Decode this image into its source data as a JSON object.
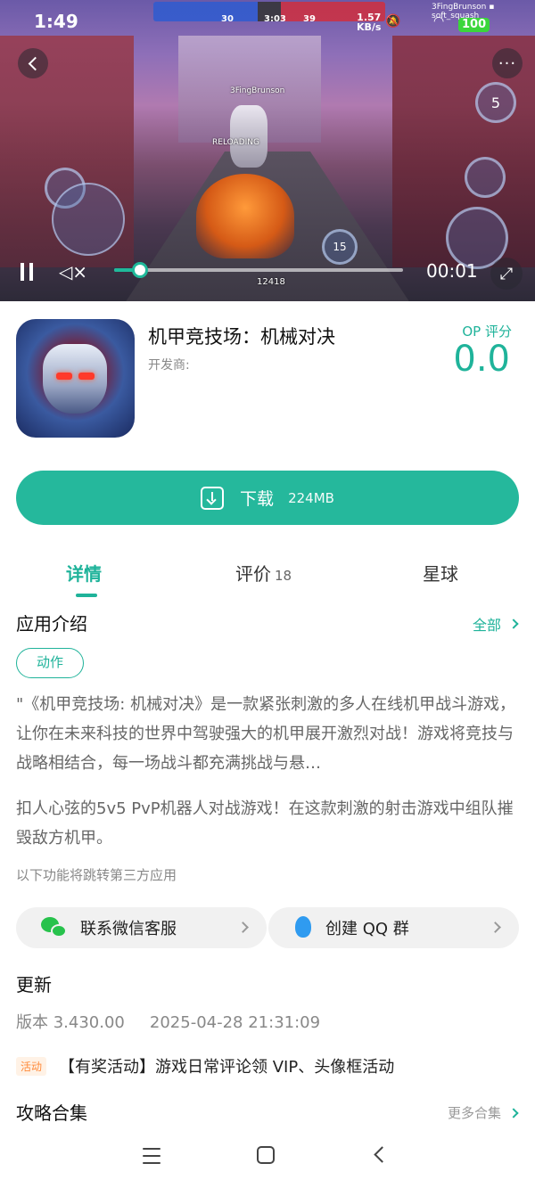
{
  "status_bar": {
    "time": "1:49",
    "network_speed": "1.57",
    "network_unit": "KB/s",
    "battery": "100",
    "player_tag": "3FingBrunson",
    "player_tag_2": "soft_squash"
  },
  "game_hud": {
    "team_blue_score": "30",
    "match_timer": "3:03",
    "team_red_score": "39",
    "player_name": "3FingBrunson",
    "reloading_text": "RELOADING",
    "ammo_count": "12418",
    "skill_cooldown": "15",
    "grenade_count": "5"
  },
  "video": {
    "time": "00:01",
    "progress": 0.09
  },
  "app": {
    "title": "机甲竞技场：机械对决",
    "developer_label": "开发商:",
    "rating_label": "OP 评分",
    "rating_value": "0.0"
  },
  "download": {
    "label": "下载",
    "size": "224MB"
  },
  "tabs": [
    {
      "label": "详情",
      "active": true
    },
    {
      "label": "评价",
      "count": "18"
    },
    {
      "label": "星球"
    }
  ],
  "intro": {
    "title": "应用介绍",
    "more": "全部",
    "tag": "动作",
    "description": "\"《机甲竞技场: 机械对决》是一款紧张刺激的多人在线机甲战斗游戏，让你在未来科技的世界中驾驶强大的机甲展开激烈对战！游戏将竞技与战略相结合，每一场战斗都充满挑战与悬…",
    "description2": "扣人心弦的5v5 PvP机器人对战游戏！在这款刺激的射击游戏中组队摧毁敌方机甲。",
    "third_party_note": "以下功能将跳转第三方应用"
  },
  "contacts": {
    "wechat": "联系微信客服",
    "qq": "创建 QQ 群"
  },
  "update": {
    "title": "更新",
    "version": "版本 3.430.00",
    "date": "2025-04-28 21:31:09"
  },
  "event": {
    "badge": "活动",
    "text": "【有奖活动】游戏日常评论领 VIP、头像框活动"
  },
  "guides": {
    "title": "攻略合集",
    "more": "更多合集"
  },
  "colors": {
    "accent": "#1fb39a",
    "download_bg": "#25b89c"
  }
}
